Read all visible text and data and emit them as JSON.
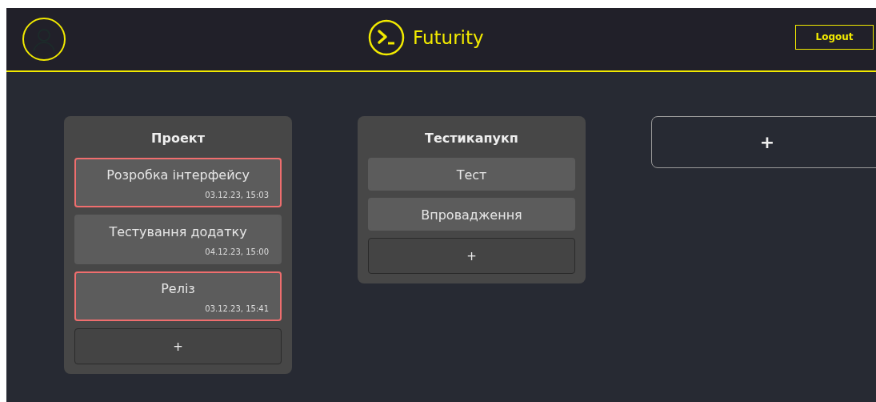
{
  "header": {
    "logo_text": "Futurity",
    "logout_button": "Logout"
  },
  "columns": [
    {
      "title": "Проект",
      "tasks": [
        {
          "title": "Розробка інтерфейсу",
          "date": "03.12.23, 15:03",
          "highlighted": true
        },
        {
          "title": "Тестування додатку",
          "date": "04.12.23, 15:00",
          "highlighted": false
        },
        {
          "title": "Реліз",
          "date": "03.12.23, 15:41",
          "highlighted": true
        }
      ],
      "add_label": "+"
    },
    {
      "title": "Тестикапукп",
      "tasks": [
        {
          "title": "Тест",
          "highlighted": false
        },
        {
          "title": "Впровадження",
          "highlighted": false
        }
      ],
      "add_label": "+"
    }
  ],
  "add_column_label": "+"
}
